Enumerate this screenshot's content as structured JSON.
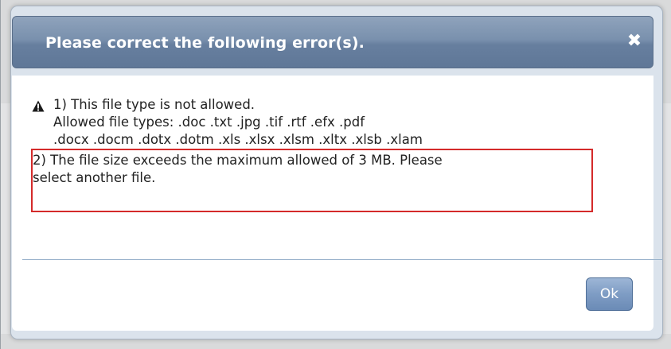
{
  "dialog": {
    "title": "Please correct the following error(s).",
    "close_glyph": "✖",
    "message_lines": [
      "1) This file type is not allowed.",
      "Allowed file types: .doc .txt .jpg .tif .rtf .efx .pdf",
      ".docx .docm .dotx .dotm .xls .xlsx .xlsm .xltx .xlsb .xlam",
      "2) The file size exceeds the maximum allowed of 3 MB. Please",
      "select another file."
    ],
    "ok_label": "Ok",
    "icons": {
      "warning": "warning-icon",
      "close": "close-icon"
    },
    "colors": {
      "title_bar": "#7990ad",
      "highlight": "#d42a2a",
      "ok_button": "#7e9cc4"
    }
  }
}
